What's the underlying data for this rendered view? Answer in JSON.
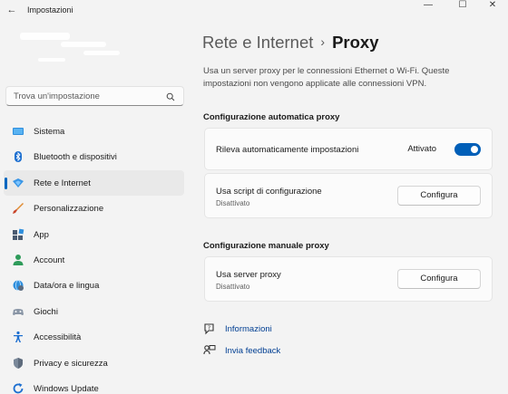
{
  "window": {
    "back_glyph": "←",
    "title": "Impostazioni",
    "minimize_glyph": "—",
    "maximize_glyph": "☐",
    "close_glyph": "✕"
  },
  "search": {
    "placeholder": "Trova un'impostazione",
    "icon": "search-icon"
  },
  "sidebar": {
    "active_index": 2,
    "items": [
      {
        "label": "Sistema",
        "icon": "monitor-icon"
      },
      {
        "label": "Bluetooth e dispositivi",
        "icon": "bluetooth-icon"
      },
      {
        "label": "Rete e Internet",
        "icon": "network-icon"
      },
      {
        "label": "Personalizzazione",
        "icon": "brush-icon"
      },
      {
        "label": "App",
        "icon": "apps-icon"
      },
      {
        "label": "Account",
        "icon": "person-icon"
      },
      {
        "label": "Data/ora e lingua",
        "icon": "globe-clock-icon"
      },
      {
        "label": "Giochi",
        "icon": "gamepad-icon"
      },
      {
        "label": "Accessibilità",
        "icon": "accessibility-icon"
      },
      {
        "label": "Privacy e sicurezza",
        "icon": "shield-icon"
      },
      {
        "label": "Windows Update",
        "icon": "update-icon"
      }
    ]
  },
  "breadcrumb": {
    "parent": "Rete e Internet",
    "separator": "›",
    "current": "Proxy"
  },
  "description": "Usa un server proxy per le connessioni Ethernet o Wi-Fi. Queste impostazioni non vengono applicate alle connessioni VPN.",
  "auto_section": {
    "title": "Configurazione automatica proxy",
    "detect": {
      "label": "Rileva automaticamente impostazioni",
      "state_label": "Attivato",
      "on": true
    },
    "script": {
      "label": "Usa script di configurazione",
      "status": "Disattivato",
      "button": "Configura"
    }
  },
  "manual_section": {
    "title": "Configurazione manuale proxy",
    "server": {
      "label": "Usa server proxy",
      "status": "Disattivato",
      "button": "Configura"
    }
  },
  "links": [
    {
      "label": "Informazioni",
      "icon": "help-icon"
    },
    {
      "label": "Invia feedback",
      "icon": "feedback-icon"
    }
  ],
  "colors": {
    "accent": "#005fb8",
    "link": "#003e92",
    "background": "#f3f3f3",
    "card": "#fbfbfb"
  }
}
